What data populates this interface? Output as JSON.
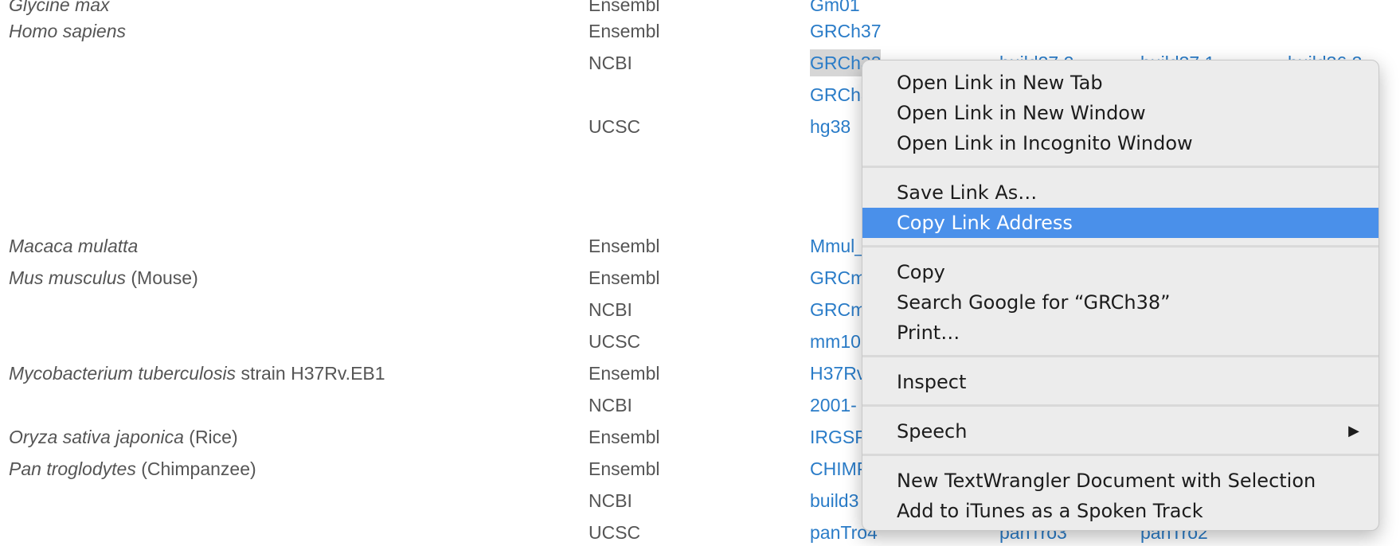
{
  "rows": [
    {
      "species": "Glycine max",
      "common": "",
      "source": "Ensembl",
      "links": [
        "Gm01"
      ]
    },
    {
      "species": "Homo sapiens",
      "common": "",
      "source": "Ensembl",
      "links": [
        "GRCh37"
      ]
    },
    {
      "species": "",
      "common": "",
      "source": "NCBI",
      "links": [
        "GRCh38",
        "build37.2",
        "build37.1",
        "build36.3"
      ]
    },
    {
      "species": "",
      "common": "",
      "source": "",
      "links": [
        "GRCh37"
      ]
    },
    {
      "species": "",
      "common": "",
      "source": "UCSC",
      "links": [
        "hg38"
      ]
    },
    {
      "species": "Macaca mulatta",
      "common": "",
      "source": "Ensembl",
      "links": [
        "Mmul_8.0.1"
      ]
    },
    {
      "species": "Mus musculus",
      "common": " (Mouse)",
      "source": "Ensembl",
      "links": [
        "GRCm38"
      ]
    },
    {
      "species": "",
      "common": "",
      "source": "NCBI",
      "links": [
        "GRCm38"
      ]
    },
    {
      "species": "",
      "common": "",
      "source": "UCSC",
      "links": [
        "mm10"
      ]
    },
    {
      "species": "Mycobacterium tuberculosis",
      "common": " strain H37Rv.EB1",
      "source": "Ensembl",
      "links": [
        "H37Rv"
      ]
    },
    {
      "species": "",
      "common": "",
      "source": "NCBI",
      "links": [
        "2001-"
      ]
    },
    {
      "species": "Oryza sativa japonica",
      "common": " (Rice)",
      "source": "Ensembl",
      "links": [
        "IRGSP"
      ]
    },
    {
      "species": "Pan troglodytes",
      "common": " (Chimpanzee)",
      "source": "Ensembl",
      "links": [
        "CHIMP"
      ]
    },
    {
      "species": "",
      "common": "",
      "source": "NCBI",
      "links": [
        "build3"
      ]
    },
    {
      "species": "",
      "common": "",
      "source": "UCSC",
      "links": [
        "panTro4",
        "panTro3",
        "panTro2"
      ]
    }
  ],
  "selected_link": "GRCh38",
  "menu": {
    "groups": [
      [
        "Open Link in New Tab",
        "Open Link in New Window",
        "Open Link in Incognito Window"
      ],
      [
        "Save Link As…",
        "Copy Link Address"
      ],
      [
        "Copy",
        "Search Google for “GRCh38”",
        "Print…"
      ],
      [
        "Inspect"
      ],
      [
        "Speech"
      ],
      [
        "New TextWrangler Document with Selection",
        "Add to iTunes as a Spoken Track"
      ]
    ],
    "active_item": "Copy Link Address",
    "submenu_items": [
      "Speech"
    ],
    "submenu_arrow": "▶"
  },
  "colors": {
    "link": "#2a7cc8",
    "text": "#555555",
    "menu_bg": "#ececec",
    "menu_highlight": "#4a90ea",
    "selection": "#d6d6d6"
  }
}
